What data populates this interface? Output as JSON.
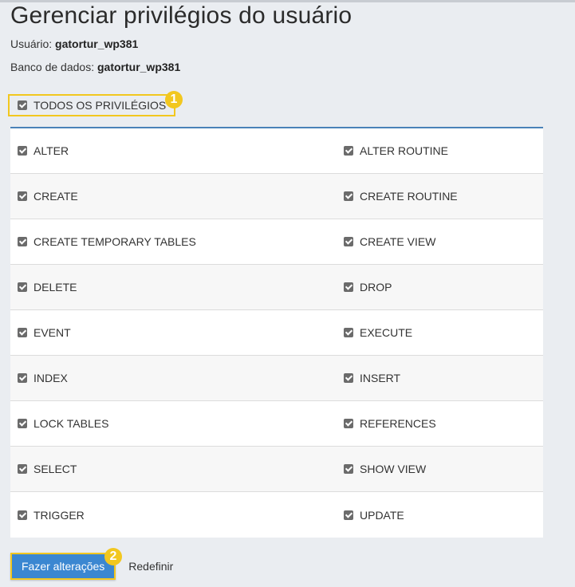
{
  "page": {
    "title": "Gerenciar privilégios do usuário",
    "user_label": "Usuário:",
    "user_value": "gatortur_wp381",
    "db_label": "Banco de dados:",
    "db_value": "gatortur_wp381"
  },
  "all_privileges": {
    "label": "TODOS OS PRIVILÉGIOS",
    "checked": true,
    "badge": "1"
  },
  "privileges": [
    {
      "left": "ALTER",
      "right": "ALTER ROUTINE"
    },
    {
      "left": "CREATE",
      "right": "CREATE ROUTINE"
    },
    {
      "left": "CREATE TEMPORARY TABLES",
      "right": "CREATE VIEW"
    },
    {
      "left": "DELETE",
      "right": "DROP"
    },
    {
      "left": "EVENT",
      "right": "EXECUTE"
    },
    {
      "left": "INDEX",
      "right": "INSERT"
    },
    {
      "left": "LOCK TABLES",
      "right": "REFERENCES"
    },
    {
      "left": "SELECT",
      "right": "SHOW VIEW"
    },
    {
      "left": "TRIGGER",
      "right": "UPDATE"
    }
  ],
  "actions": {
    "submit_label": "Fazer alterações",
    "submit_badge": "2",
    "reset_label": "Redefinir"
  },
  "colors": {
    "accent": "#3b87d1",
    "highlight": "#f2c71f",
    "grid_border": "#4a82b8",
    "background": "#eaedf1"
  }
}
